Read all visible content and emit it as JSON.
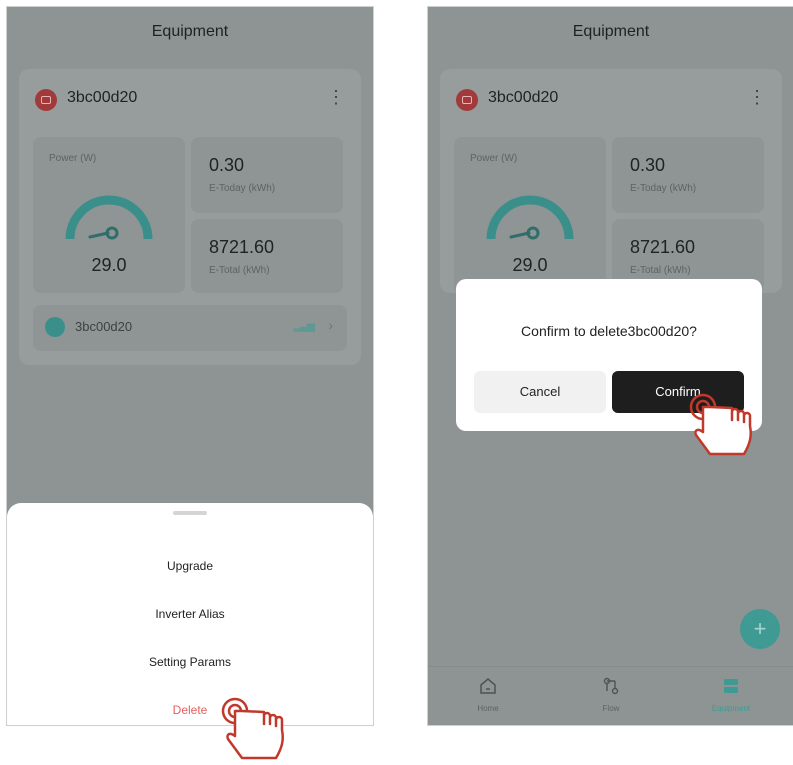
{
  "left_screen": {
    "header_title": "Equipment",
    "device": {
      "name": "3bc00d20",
      "power_label": "Power (W)",
      "power_value": "29.0",
      "e_today_value": "0.30",
      "e_today_label": "E-Today (kWh)",
      "e_total_value": "8721.60",
      "e_total_label": "E-Total (kWh)",
      "sub_device_name": "3bc00d20"
    },
    "sheet": {
      "upgrade": "Upgrade",
      "inverter_alias": "Inverter Alias",
      "setting_params": "Setting Params",
      "delete": "Delete"
    }
  },
  "right_screen": {
    "header_title": "Equipment",
    "device": {
      "name": "3bc00d20",
      "power_label": "Power (W)",
      "power_value": "29.0",
      "e_today_value": "0.30",
      "e_today_label": "E-Today (kWh)",
      "e_total_value": "8721.60",
      "e_total_label": "E-Total (kWh)"
    },
    "dialog": {
      "message": "Confirm to delete3bc00d20?",
      "cancel": "Cancel",
      "confirm": "Confirm"
    },
    "fab_label": "+",
    "tabs": [
      {
        "label": "Home",
        "icon": "home-icon"
      },
      {
        "label": "Flow",
        "icon": "flow-icon"
      },
      {
        "label": "Equipment",
        "icon": "equipment-icon"
      }
    ]
  },
  "colors": {
    "accent": "#3f9a93",
    "danger": "#e0605f",
    "tap_hand": "#c0392b"
  }
}
